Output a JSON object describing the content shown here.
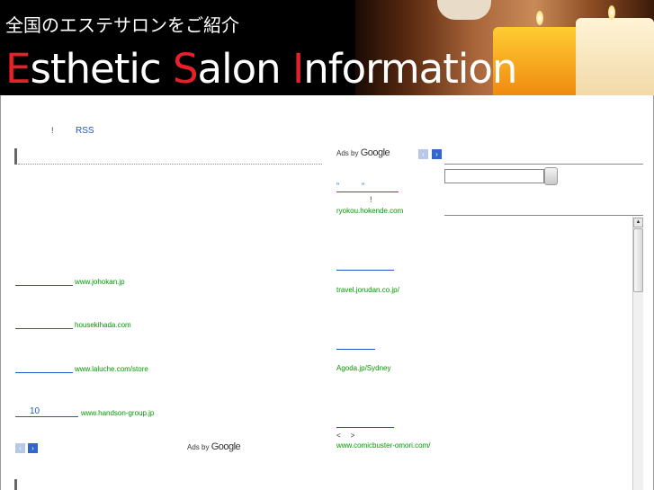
{
  "banner": {
    "jp_title": "全国のエステサロンをご紹介",
    "en_title_parts": [
      "E",
      "sthetic ",
      "S",
      "alon ",
      "I",
      "nformation"
    ]
  },
  "top_links": {
    "bang": "!",
    "rss": "RSS"
  },
  "ads_label": {
    "prefix": "Ads by",
    "brand": "Google"
  },
  "nav": {
    "prev": "‹",
    "next": "›"
  },
  "left_ads": [
    {
      "link": "",
      "url": "www.johokan.jp"
    },
    {
      "link": "",
      "url": "housekihada.com"
    },
    {
      "link": "",
      "url": "www.laluche.com/store"
    },
    {
      "link": "10",
      "url": "www.handson-group.jp"
    }
  ],
  "right_ads": [
    {
      "link": "”          ”",
      "desc": "!",
      "url": "ryokou.hokende.com"
    },
    {
      "link": "",
      "desc": "",
      "url": "travel.jorudan.co.jp/"
    },
    {
      "link": "",
      "desc": "",
      "url": "Agoda.jp/Sydney"
    },
    {
      "link": "",
      "desc": "<     >",
      "url": "www.comicbuster-omori.com/"
    }
  ]
}
